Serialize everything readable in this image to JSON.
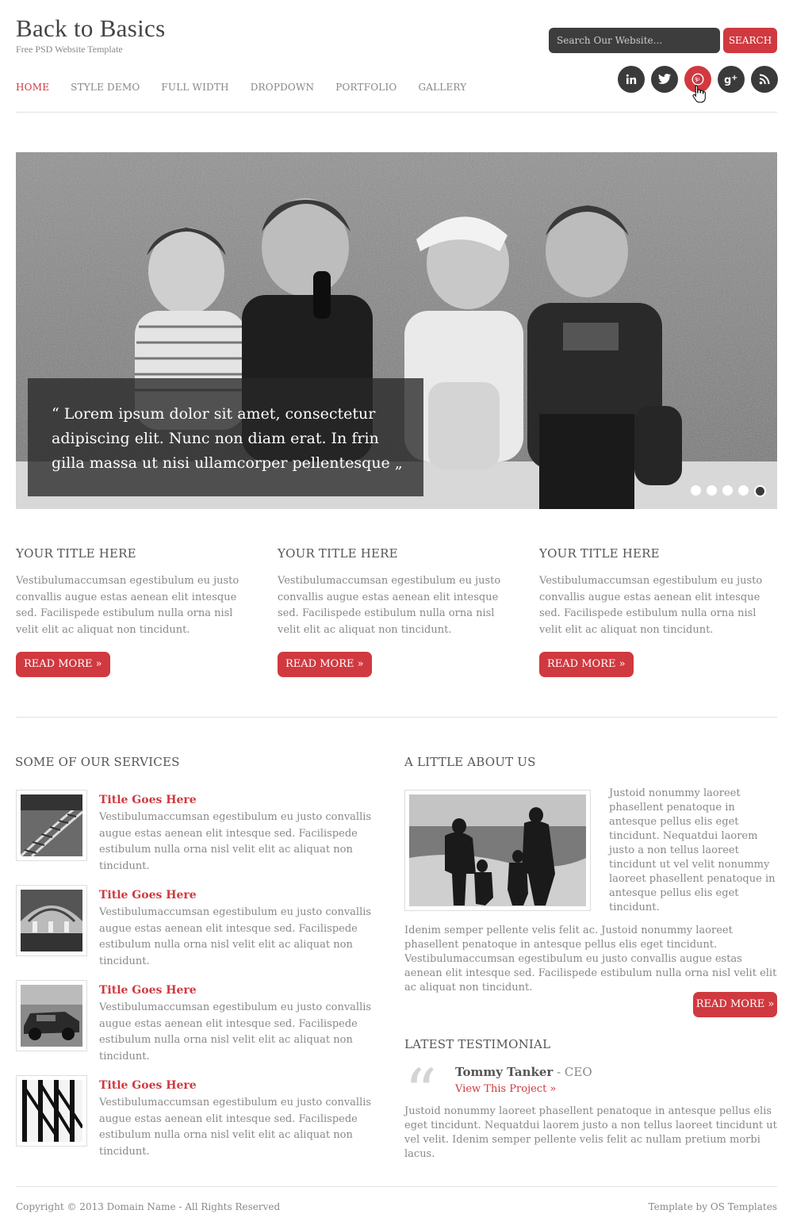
{
  "header": {
    "logo": "Back to Basics",
    "tagline": "Free PSD Website Template",
    "search_placeholder": "Search Our Website...",
    "search_button": "SEARCH"
  },
  "nav": [
    {
      "label": "HOME",
      "active": true
    },
    {
      "label": "STYLE DEMO",
      "active": false
    },
    {
      "label": "FULL WIDTH",
      "active": false
    },
    {
      "label": "DROPDOWN",
      "active": false
    },
    {
      "label": "PORTFOLIO",
      "active": false
    },
    {
      "label": "GALLERY",
      "active": false
    }
  ],
  "social": [
    "linkedin-icon",
    "twitter-icon",
    "pinterest-icon",
    "google-plus-icon",
    "rss-icon"
  ],
  "slider": {
    "caption": "“ Lorem ipsum dolor sit amet, consectetur adipiscing elit. Nunc non diam erat. In frin gilla massa ut nisi ullamcorper pellentesque „",
    "dot_count": 5,
    "active_dot": 5
  },
  "columns": [
    {
      "title": "YOUR TITLE HERE",
      "text": "Vestibulumaccumsan egestibulum eu justo convallis augue estas aenean elit intesque sed. Facilispede estibulum nulla orna nisl velit elit ac aliquat non tincidunt.",
      "button": "READ MORE »"
    },
    {
      "title": "YOUR TITLE HERE",
      "text": "Vestibulumaccumsan egestibulum eu justo convallis augue estas aenean elit intesque sed. Facilispede estibulum nulla orna nisl velit elit ac aliquat non tincidunt.",
      "button": "READ MORE »"
    },
    {
      "title": "YOUR TITLE HERE",
      "text": "Vestibulumaccumsan egestibulum eu justo convallis augue estas aenean elit intesque sed. Facilispede estibulum nulla orna nisl velit elit ac aliquat non tincidunt.",
      "button": "READ MORE »"
    }
  ],
  "services": {
    "heading": "SOME OF OUR SERVICES",
    "items": [
      {
        "title": "Title Goes Here",
        "text": "Vestibulumaccumsan egestibulum eu justo convallis augue estas aenean elit intesque sed. Facilispede estibulum nulla orna nisl velit elit ac aliquat non tincidunt."
      },
      {
        "title": "Title Goes Here",
        "text": "Vestibulumaccumsan egestibulum eu justo convallis augue estas aenean elit intesque sed. Facilispede estibulum nulla orna nisl velit elit ac aliquat non tincidunt."
      },
      {
        "title": "Title Goes Here",
        "text": "Vestibulumaccumsan egestibulum eu justo convallis augue estas aenean elit intesque sed. Facilispede estibulum nulla orna nisl velit elit ac aliquat non tincidunt."
      },
      {
        "title": "Title Goes Here",
        "text": "Vestibulumaccumsan egestibulum eu justo convallis augue estas aenean elit intesque sed. Facilispede estibulum nulla orna nisl velit elit ac aliquat non tincidunt."
      }
    ]
  },
  "about": {
    "heading": "A LITTLE ABOUT US",
    "side_text": "Justoid nonummy laoreet phasellent penatoque in antesque pellus elis eget tincidunt. Nequatdui laorem justo a non tellus laoreet tincidunt ut vel velit nonummy laoreet phasellent penatoque in antesque pellus elis eget tincidunt.",
    "body_text": "Idenim semper pellente velis felit ac. Justoid nonummy laoreet phasellent penatoque in antesque pellus elis eget tincidunt. Vestibulumaccumsan egestibulum eu justo convallis augue estas aenean elit intesque sed. Facilispede estibulum nulla orna nisl velit elit ac aliquat non tincidunt.",
    "button": "READ MORE »"
  },
  "testimonial": {
    "heading": "LATEST TESTIMONIAL",
    "name": "Tommy Tanker",
    "role": " - CEO",
    "link": "View This Project »",
    "text": "Justoid nonummy laoreet phasellent penatoque in antesque pellus elis eget tincidunt. Nequatdui laorem justo a non tellus laoreet tincidunt ut vel velit. Idenim semper pellente velis felit ac nullam pretium morbi lacus."
  },
  "footer": {
    "copyright": "Copyright © 2013 Domain Name - All Rights Reserved",
    "credit": "Template by OS Templates"
  },
  "colors": {
    "accent": "#d0393f",
    "dark": "#3a3a3a"
  }
}
